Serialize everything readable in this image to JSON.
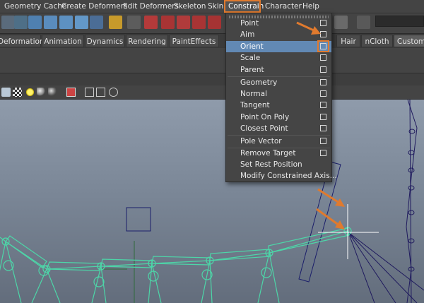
{
  "menu": [
    "Geometry Cache",
    "Create Deformers",
    "Edit Deformers",
    "Skeleton",
    "Skin",
    "Constrain",
    "Character",
    "Help"
  ],
  "active_menu": "Constrain",
  "shelf_tabs": [
    "Deformation",
    "Animation",
    "Dynamics",
    "Rendering",
    "PaintEffects",
    "Hair",
    "nCloth",
    "Custom"
  ],
  "current_shelf_tab": "Custom",
  "dropdown_items": [
    {
      "label": "Point",
      "option_box": true
    },
    {
      "label": "Aim",
      "option_box": true
    },
    {
      "label": "Orient",
      "option_box": true,
      "highlighted": true
    },
    {
      "label": "Scale",
      "option_box": true
    },
    {
      "label": "Parent",
      "option_box": true
    },
    {
      "label": "Geometry",
      "option_box": true
    },
    {
      "label": "Normal",
      "option_box": true
    },
    {
      "label": "Tangent",
      "option_box": true
    },
    {
      "label": "Point On Poly",
      "option_box": true
    },
    {
      "label": "Closest Point",
      "option_box": true
    },
    {
      "label": "Pole Vector",
      "option_box": true
    },
    {
      "label": "Remove Target",
      "option_box": true
    },
    {
      "label": "Set Rest Position",
      "option_box": false
    },
    {
      "label": "Modify Constrained Axis...",
      "option_box": false
    }
  ],
  "colors": {
    "accent_outline": "#e07a2e",
    "highlight": "#6289b4",
    "joint_color": "#4dd6a8",
    "locator_color": "#1b1e6a"
  }
}
